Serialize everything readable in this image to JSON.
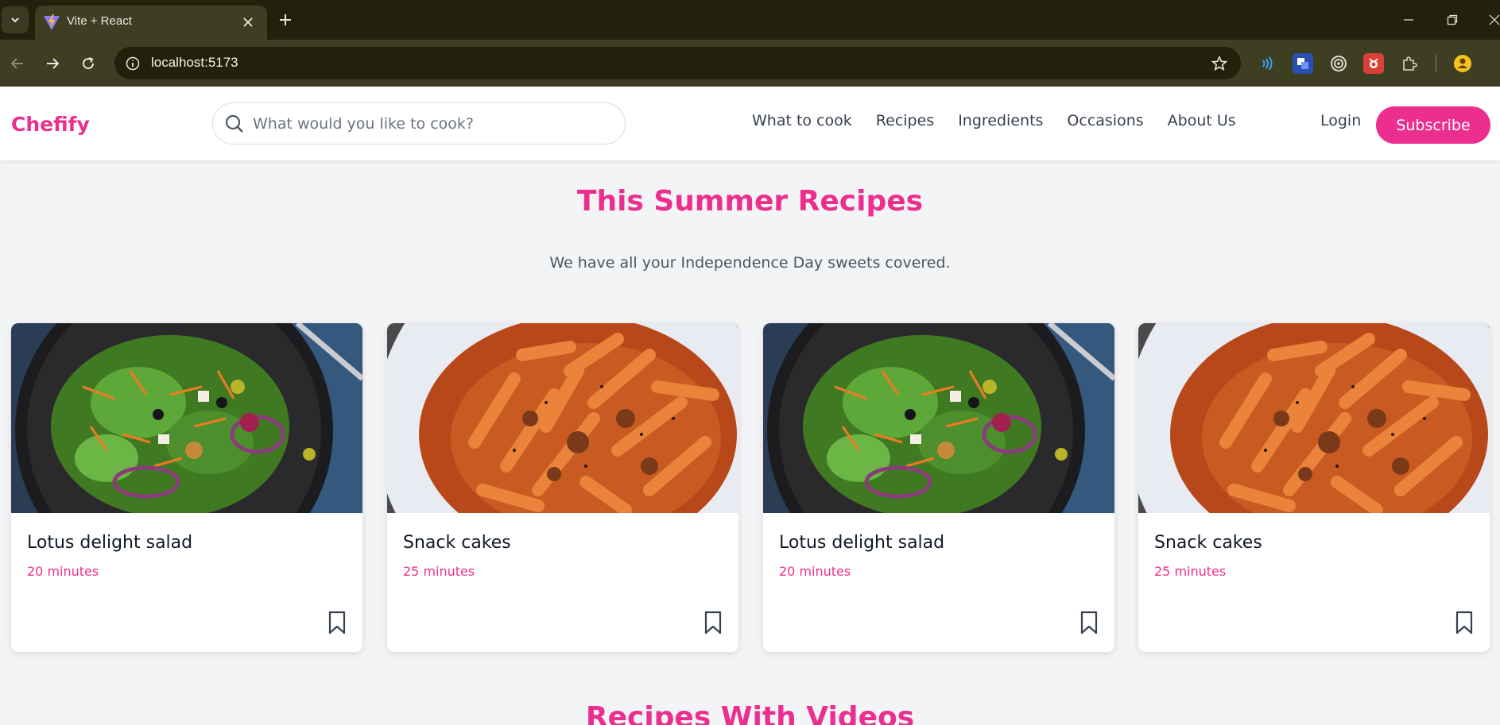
{
  "browser": {
    "tab_title": "Vite + React",
    "url": "localhost:5173",
    "icons": [
      "tab-search-icon",
      "vite-logo-icon",
      "close-icon",
      "plus-icon",
      "back-icon",
      "forward-icon",
      "reload-icon",
      "site-info-icon",
      "star-icon",
      "extensions-icon",
      "minimize-icon",
      "restore-icon",
      "window-close-icon"
    ]
  },
  "header": {
    "logo": "Chefify",
    "search_placeholder": "What would you like to cook?",
    "nav": [
      "What to cook",
      "Recipes",
      "Ingredients",
      "Occasions",
      "About Us"
    ],
    "login": "Login",
    "subscribe": "Subscribe"
  },
  "summer": {
    "title": "This Summer Recipes",
    "subtitle": "We have all your Independence Day sweets covered.",
    "cards": [
      {
        "title": "Lotus delight salad",
        "time": "20 minutes",
        "image": "salad"
      },
      {
        "title": "Snack cakes",
        "time": "25 minutes",
        "image": "pasta"
      },
      {
        "title": "Lotus delight salad",
        "time": "20 minutes",
        "image": "salad"
      },
      {
        "title": "Snack cakes",
        "time": "25 minutes",
        "image": "pasta"
      }
    ]
  },
  "videos": {
    "title": "Recipes With Videos"
  },
  "colors": {
    "accent": "#ec2f8f",
    "chrome_dark": "#22220c",
    "chrome_toolbar": "#3d3e22"
  }
}
